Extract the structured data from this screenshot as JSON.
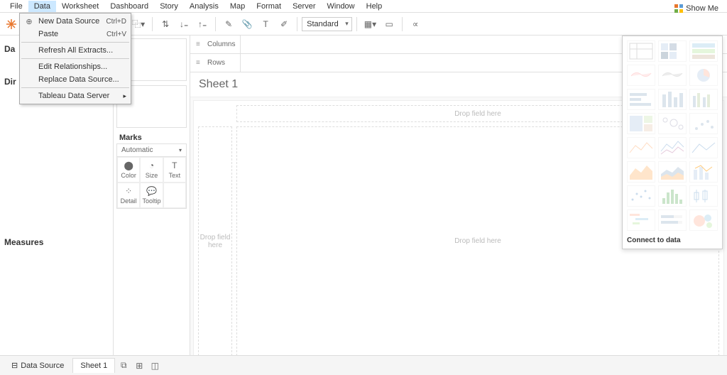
{
  "menubar": [
    "File",
    "Data",
    "Worksheet",
    "Dashboard",
    "Story",
    "Analysis",
    "Map",
    "Format",
    "Server",
    "Window",
    "Help"
  ],
  "active_menu_index": 1,
  "data_menu": {
    "new_data_source": "New Data Source",
    "new_data_source_shortcut": "Ctrl+D",
    "paste": "Paste",
    "paste_shortcut": "Ctrl+V",
    "refresh": "Refresh All Extracts...",
    "edit_rel": "Edit Relationships...",
    "replace": "Replace Data Source...",
    "tds": "Tableau Data Server"
  },
  "toolbar": {
    "fit_select": "Standard"
  },
  "left": {
    "data_header": "Da",
    "dimensions": "Dir",
    "measures": "Measures"
  },
  "marks": {
    "title": "Marks",
    "type": "Automatic",
    "cells": [
      "Color",
      "Size",
      "Text",
      "Detail",
      "Tooltip"
    ]
  },
  "shelves": {
    "columns": "Columns",
    "rows": "Rows"
  },
  "sheet_title": "Sheet 1",
  "drop_hints": {
    "top": "Drop field here",
    "left": "Drop field here",
    "main": "Drop field here"
  },
  "showme": {
    "button": "Show Me",
    "footer": "Connect to data"
  },
  "bottom": {
    "data_source": "Data Source",
    "sheet1": "Sheet 1"
  }
}
